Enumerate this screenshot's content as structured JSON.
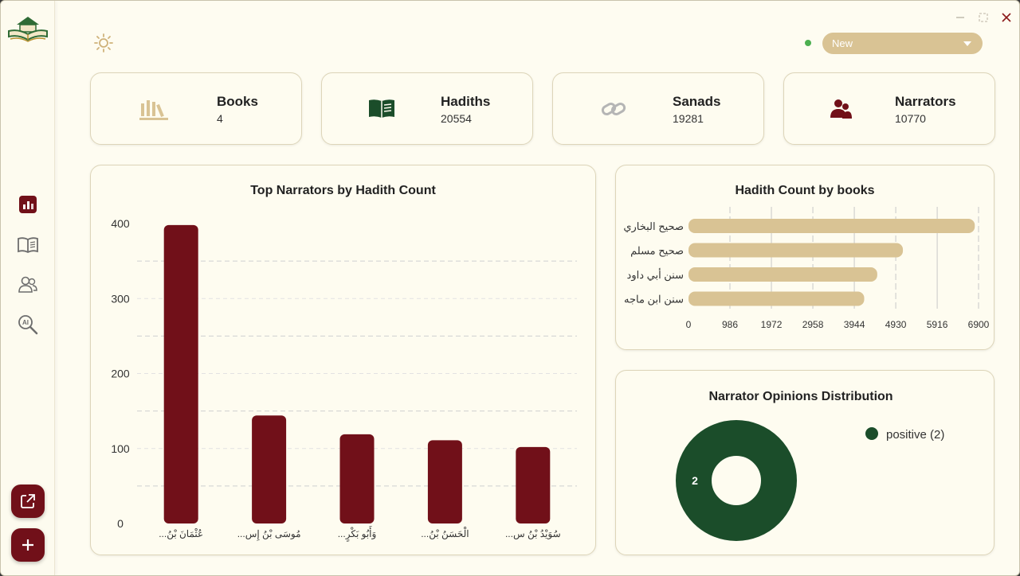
{
  "header": {
    "theme_icon": "sun-icon",
    "status_color": "#4caf50",
    "dropdown_value": "New"
  },
  "window_controls": {
    "minimize": "minimize-icon",
    "maximize": "maximize-icon",
    "close": "close-icon"
  },
  "sidebar": {
    "logo": "book-logo",
    "items": [
      {
        "icon": "bar-chart-icon",
        "active": true
      },
      {
        "icon": "open-book-icon",
        "active": false
      },
      {
        "icon": "users-icon",
        "active": false
      },
      {
        "icon": "ai-search-icon",
        "active": false
      }
    ],
    "actions": [
      {
        "icon": "external-link-icon"
      },
      {
        "icon": "plus-icon"
      }
    ]
  },
  "stats": [
    {
      "label": "Books",
      "value": "4",
      "icon": "books-icon"
    },
    {
      "label": "Hadiths",
      "value": "20554",
      "icon": "book-icon"
    },
    {
      "label": "Sanads",
      "value": "19281",
      "icon": "link-icon"
    },
    {
      "label": "Narrators",
      "value": "10770",
      "icon": "users-icon"
    }
  ],
  "colors": {
    "accent": "#711019",
    "tan": "#d9c394",
    "green": "#1b4d2a",
    "background": "#fefcf1"
  },
  "chart_data": [
    {
      "type": "bar",
      "title": "Top Narrators by Hadith Count",
      "categories": [
        "عُثْمَانَ بْنُ...",
        "مُوسَى بْنُ إِس...",
        "وَأَبُو بَكْرٍ...",
        "الْحَسَنُ بْنُ...",
        "سُوَيْدُ بْنُ س..."
      ],
      "values": [
        398,
        144,
        119,
        111,
        102
      ],
      "yticks": [
        "0",
        "100",
        "200",
        "300",
        "400"
      ],
      "ylim": [
        0,
        400
      ],
      "color": "#711019",
      "grid": true
    },
    {
      "type": "bar",
      "orientation": "horizontal",
      "title": "Hadith Count by books",
      "categories": [
        "صحيح البخاري",
        "صحيح مسلم",
        "سنن أبي داود",
        "سنن ابن ماجه"
      ],
      "values": [
        6810,
        5100,
        4490,
        4180
      ],
      "xticks": [
        "0",
        "986",
        "1972",
        "2958",
        "3944",
        "4930",
        "5916",
        "6900"
      ],
      "xlim": [
        0,
        6900
      ],
      "color": "#d9c394",
      "grid": true
    },
    {
      "type": "pie",
      "title": "Narrator Opinions Distribution",
      "slices": [
        {
          "label": "positive (2)",
          "value": 2,
          "data_label": "2",
          "color": "#1b4d2a"
        }
      ],
      "donut": true,
      "legend": "top-right"
    }
  ]
}
